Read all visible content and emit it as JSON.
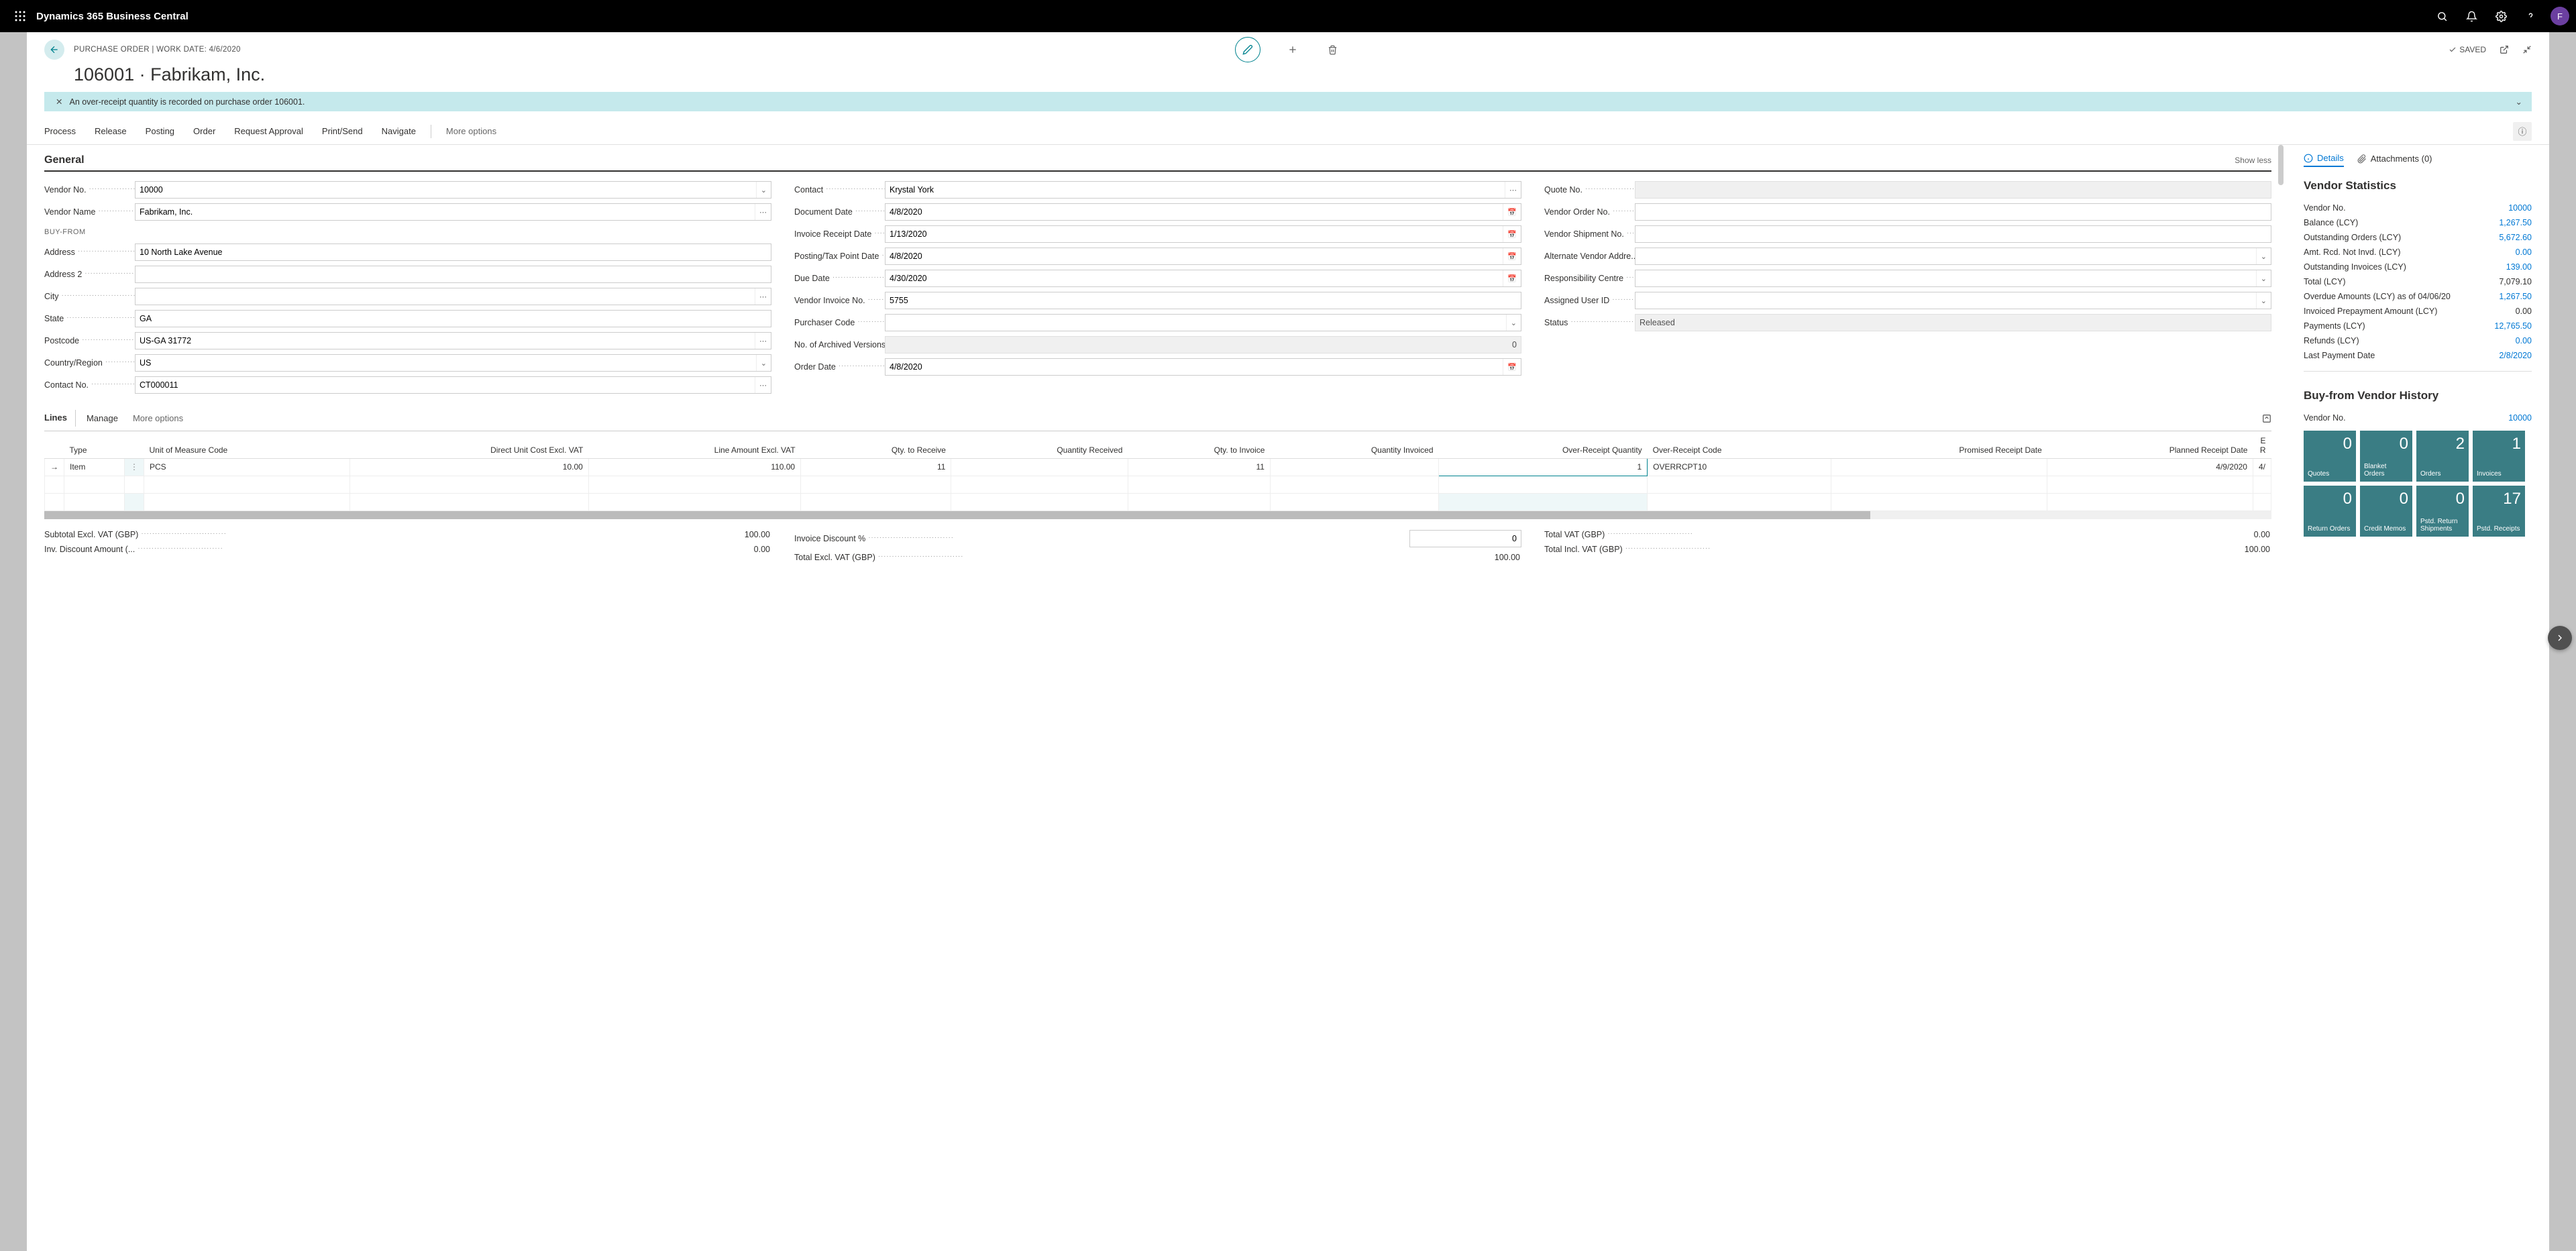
{
  "topbar": {
    "appTitle": "Dynamics 365 Business Central",
    "avatar": "F"
  },
  "header": {
    "breadcrumb": "PURCHASE ORDER | WORK DATE: 4/6/2020",
    "title": "106001 · Fabrikam, Inc.",
    "saved": "SAVED"
  },
  "banner": {
    "text": "An over-receipt quantity is recorded on purchase order 106001."
  },
  "actions": {
    "process": "Process",
    "release": "Release",
    "posting": "Posting",
    "order": "Order",
    "requestApproval": "Request Approval",
    "printSend": "Print/Send",
    "navigate": "Navigate",
    "more": "More options"
  },
  "general": {
    "heading": "General",
    "showless": "Show less",
    "col1": {
      "vendorNoLbl": "Vendor No.",
      "vendorNo": "10000",
      "vendorNameLbl": "Vendor Name",
      "vendorName": "Fabrikam, Inc.",
      "buyFrom": "BUY-FROM",
      "addressLbl": "Address",
      "address": "10 North Lake Avenue",
      "address2Lbl": "Address 2",
      "address2": "",
      "cityLbl": "City",
      "city": "",
      "stateLbl": "State",
      "state": "GA",
      "postcodeLbl": "Postcode",
      "postcode": "US-GA 31772",
      "countryLbl": "Country/Region",
      "country": "US",
      "contactNoLbl": "Contact No.",
      "contactNo": "CT000011"
    },
    "col2": {
      "contactLbl": "Contact",
      "contact": "Krystal York",
      "docDateLbl": "Document Date",
      "docDate": "4/8/2020",
      "invRcptLbl": "Invoice Receipt Date",
      "invRcpt": "1/13/2020",
      "postingLbl": "Posting/Tax Point Date",
      "posting": "4/8/2020",
      "dueDateLbl": "Due Date",
      "dueDate": "4/30/2020",
      "vendInvLbl": "Vendor Invoice No.",
      "vendInv": "5755",
      "purchCodeLbl": "Purchaser Code",
      "purchCode": "",
      "archVerLbl": "No. of Archived Versions",
      "archVer": "0",
      "orderDateLbl": "Order Date",
      "orderDate": "4/8/2020"
    },
    "col3": {
      "quoteNoLbl": "Quote No.",
      "quoteNo": "",
      "vendOrderLbl": "Vendor Order No.",
      "vendOrder": "",
      "vendShipLbl": "Vendor Shipment No.",
      "vendShip": "",
      "altVendLbl": "Alternate Vendor Addre...",
      "altVend": "",
      "respCtrLbl": "Responsibility Centre",
      "respCtr": "",
      "assignedLbl": "Assigned User ID",
      "assigned": "",
      "statusLbl": "Status",
      "status": "Released"
    }
  },
  "lines": {
    "tab": "Lines",
    "manage": "Manage",
    "more": "More options",
    "cols": {
      "type": "Type",
      "uom": "Unit of Measure Code",
      "duc": "Direct Unit Cost Excl. VAT",
      "la": "Line Amount Excl. VAT",
      "qtr": "Qty. to Receive",
      "qr": "Quantity Received",
      "qti": "Qty. to Invoice",
      "qi": "Quantity Invoiced",
      "orq": "Over-Receipt Quantity",
      "orc": "Over-Receipt Code",
      "prd": "Promised Receipt Date",
      "pld": "Planned Receipt Date",
      "er": "E R"
    },
    "row": {
      "type": "Item",
      "uom": "PCS",
      "duc": "10.00",
      "la": "110.00",
      "qtr": "11",
      "qr": "",
      "qti": "11",
      "qi": "",
      "orq": "1",
      "orc": "OVERRCPT10",
      "prd": "",
      "pld": "4/9/2020",
      "er": "4/"
    }
  },
  "totals": {
    "subtotalLbl": "Subtotal Excl. VAT (GBP)",
    "subtotal": "100.00",
    "invDiscAmtLbl": "Inv. Discount Amount (...",
    "invDiscAmt": "0.00",
    "invDiscPctLbl": "Invoice Discount %",
    "invDiscPct": "0",
    "totalExclLbl": "Total Excl. VAT (GBP)",
    "totalExcl": "100.00",
    "totalVatLbl": "Total VAT (GBP)",
    "totalVat": "0.00",
    "totalInclLbl": "Total Incl. VAT (GBP)",
    "totalIncl": "100.00"
  },
  "rightPanel": {
    "detailsTab": "Details",
    "attachTab": "Attachments (0)",
    "vstatHead": "Vendor Statistics",
    "stats": {
      "vendNoLbl": "Vendor No.",
      "vendNo": "10000",
      "balLbl": "Balance (LCY)",
      "bal": "1,267.50",
      "outOrdLbl": "Outstanding Orders (LCY)",
      "outOrd": "5,672.60",
      "amtRcdLbl": "Amt. Rcd. Not Invd. (LCY)",
      "amtRcd": "0.00",
      "outInvLbl": "Outstanding Invoices (LCY)",
      "outInv": "139.00",
      "totalLbl": "Total (LCY)",
      "total": "7,079.10",
      "overdueLbl": "Overdue Amounts (LCY) as of 04/06/20",
      "overdue": "1,267.50",
      "invPrepLbl": "Invoiced Prepayment Amount (LCY)",
      "invPrep": "0.00",
      "paymLbl": "Payments (LCY)",
      "paym": "12,765.50",
      "refLbl": "Refunds (LCY)",
      "ref": "0.00",
      "lastPayLbl": "Last Payment Date",
      "lastPay": "2/8/2020"
    },
    "vhistHead": "Buy-from Vendor History",
    "histVendNoLbl": "Vendor No.",
    "histVendNo": "10000",
    "tiles": [
      {
        "n": "0",
        "l": "Quotes"
      },
      {
        "n": "0",
        "l": "Blanket Orders"
      },
      {
        "n": "2",
        "l": "Orders"
      },
      {
        "n": "1",
        "l": "Invoices"
      },
      {
        "n": "0",
        "l": "Return Orders"
      },
      {
        "n": "0",
        "l": "Credit Memos"
      },
      {
        "n": "0",
        "l": "Pstd. Return Shipments"
      },
      {
        "n": "17",
        "l": "Pstd. Receipts"
      }
    ]
  }
}
